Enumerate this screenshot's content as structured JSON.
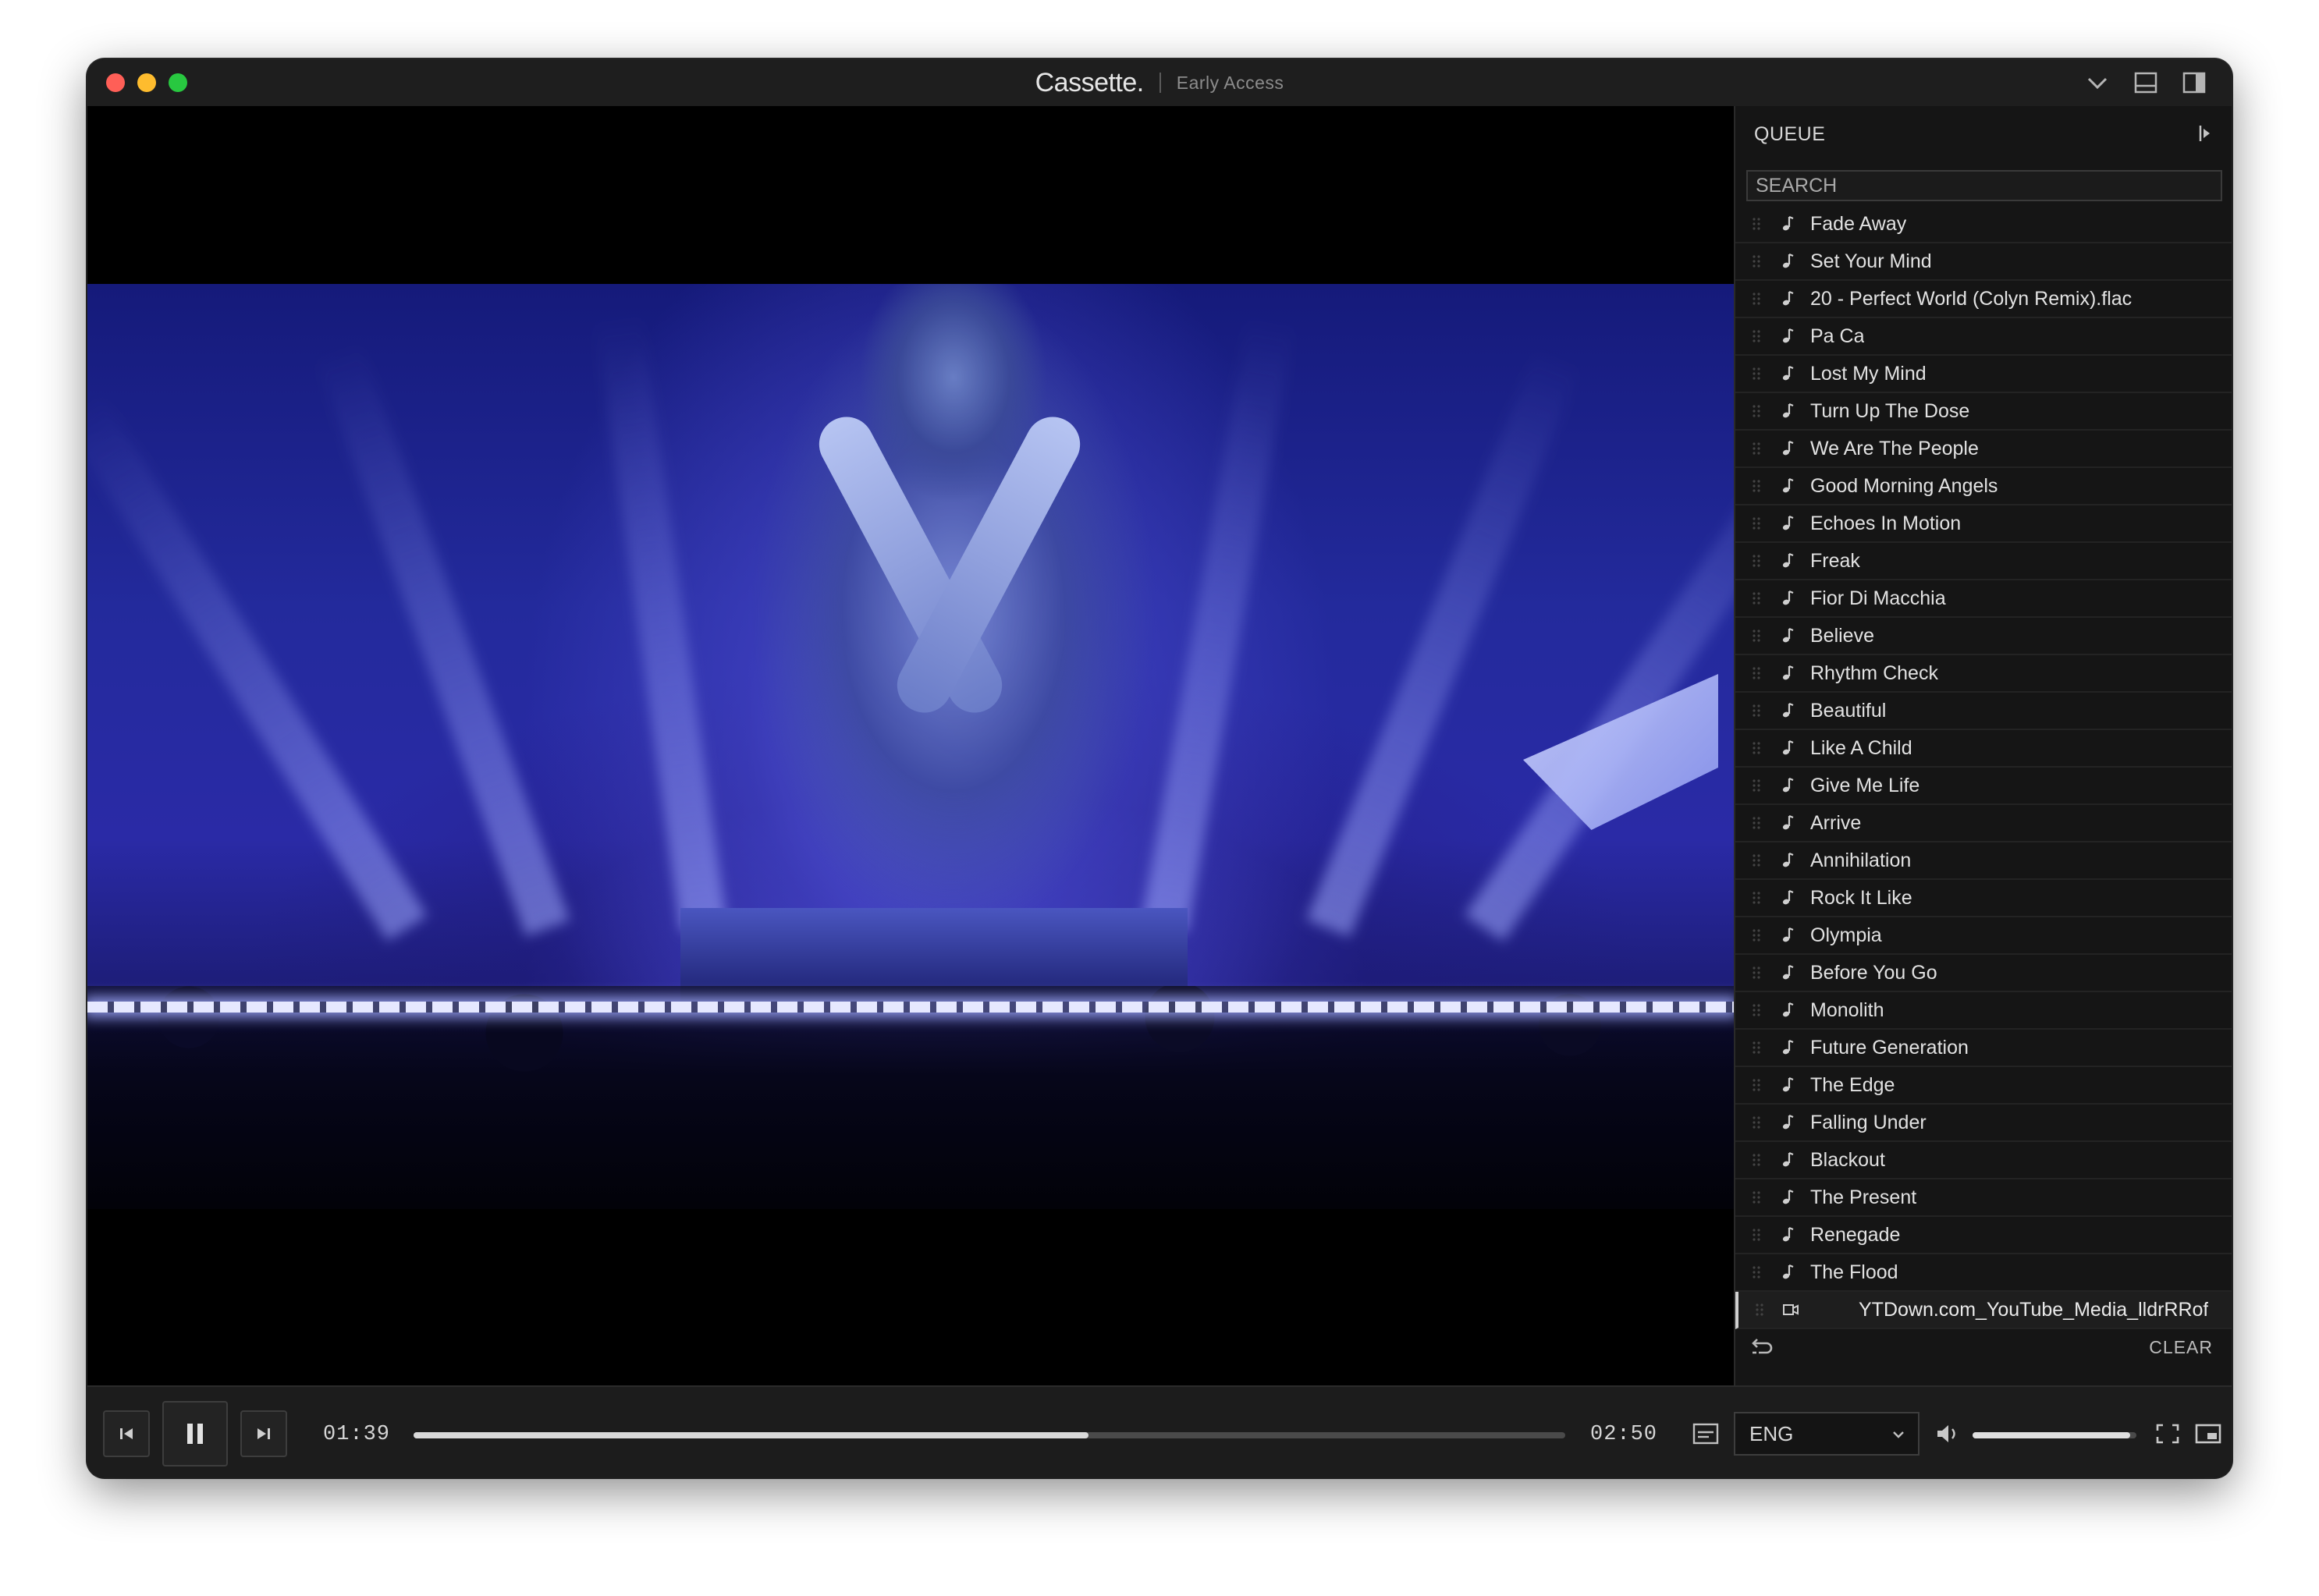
{
  "window": {
    "title": "Cassette.",
    "subtitle": "Early Access"
  },
  "titlebar_icons": [
    "chevron-down-icon",
    "bottom-panel-icon",
    "sidebar-right-icon"
  ],
  "queue": {
    "heading": "QUEUE",
    "search_placeholder": "SEARCH",
    "items": [
      {
        "label": "Fade Away",
        "type": "audio"
      },
      {
        "label": "Set Your Mind",
        "type": "audio"
      },
      {
        "label": "20 - Perfect World (Colyn Remix).flac",
        "type": "audio"
      },
      {
        "label": "Pa Ca",
        "type": "audio"
      },
      {
        "label": "Lost My Mind",
        "type": "audio"
      },
      {
        "label": "Turn Up The Dose",
        "type": "audio"
      },
      {
        "label": "We Are The People",
        "type": "audio"
      },
      {
        "label": "Good Morning Angels",
        "type": "audio"
      },
      {
        "label": "Echoes In Motion",
        "type": "audio"
      },
      {
        "label": "Freak",
        "type": "audio"
      },
      {
        "label": "Fior Di Macchia",
        "type": "audio"
      },
      {
        "label": "Believe",
        "type": "audio"
      },
      {
        "label": "Rhythm Check",
        "type": "audio"
      },
      {
        "label": "Beautiful",
        "type": "audio"
      },
      {
        "label": "Like A Child",
        "type": "audio"
      },
      {
        "label": "Give Me Life",
        "type": "audio"
      },
      {
        "label": "Arrive",
        "type": "audio"
      },
      {
        "label": "Annihilation",
        "type": "audio"
      },
      {
        "label": "Rock It Like",
        "type": "audio"
      },
      {
        "label": "Olympia",
        "type": "audio"
      },
      {
        "label": "Before You Go",
        "type": "audio"
      },
      {
        "label": "Monolith",
        "type": "audio"
      },
      {
        "label": "Future Generation",
        "type": "audio"
      },
      {
        "label": "The Edge",
        "type": "audio"
      },
      {
        "label": "Falling Under",
        "type": "audio"
      },
      {
        "label": "Blackout",
        "type": "audio"
      },
      {
        "label": "The Present",
        "type": "audio"
      },
      {
        "label": "Renegade",
        "type": "audio"
      },
      {
        "label": "The Flood",
        "type": "audio"
      },
      {
        "label": "YTDown.com_YouTube_Media_lldrRRof",
        "type": "video",
        "active": true
      }
    ],
    "clear_label": "CLEAR"
  },
  "player": {
    "current_time": "01:39",
    "duration": "02:50",
    "progress_fraction": 0.586,
    "audio_language": "ENG",
    "volume_fraction": 0.96,
    "state": "playing"
  },
  "colors": {
    "window_bg": "#000000",
    "panel_bg": "#151515",
    "controls_bg": "#1c1c1c",
    "accent_text": "#e2e2e2"
  }
}
